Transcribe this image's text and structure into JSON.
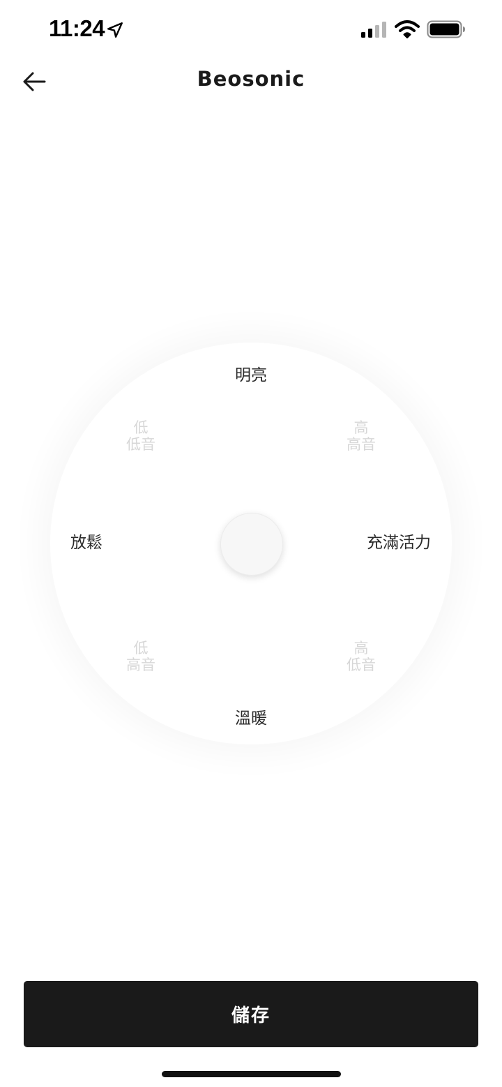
{
  "status_bar": {
    "time": "11:24",
    "icons": [
      "location-arrow-icon",
      "cellular-signal-icon",
      "wifi-icon",
      "battery-icon"
    ]
  },
  "header": {
    "title": "Beosonic",
    "back_icon": "arrow-left-icon"
  },
  "wheel": {
    "moods": {
      "top": "明亮",
      "bottom": "溫暖",
      "left": "放鬆",
      "right": "充滿活力"
    },
    "tones": {
      "top_left": {
        "line1": "低",
        "line2": "低音"
      },
      "top_right": {
        "line1": "高",
        "line2": "高音"
      },
      "bottom_left": {
        "line1": "低",
        "line2": "高音"
      },
      "bottom_right": {
        "line1": "高",
        "line2": "低音"
      }
    }
  },
  "footer": {
    "save_label": "儲存"
  },
  "colors": {
    "background": "#ffffff",
    "button": "#1a1a1a",
    "button_text": "#ffffff",
    "tone_text": "#d7d7d7"
  }
}
